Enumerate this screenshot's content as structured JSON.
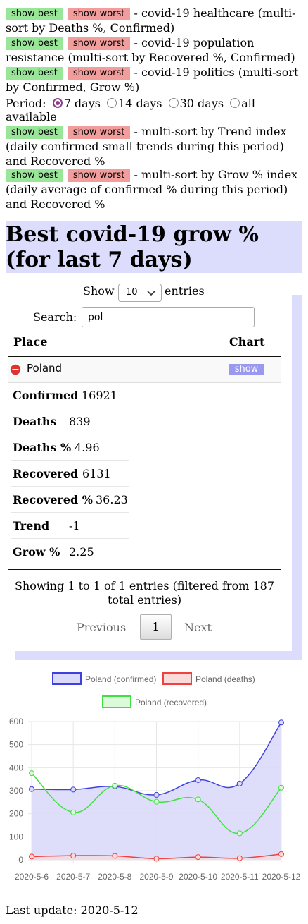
{
  "controls": {
    "show_best": "show best",
    "show_worst": "show worst",
    "rows": [
      {
        "text": "- covid-19 healthcare (multi-sort by Deaths %, Confirmed)"
      },
      {
        "text": "- covid-19 population resistance (multi-sort by Recovered %, Confirmed)"
      },
      {
        "text": "- covid-19 politics (multi-sort by Confirmed, Grow %)"
      },
      {
        "text": "- multi-sort by Trend index (daily confirmed small trends during this period) and Recovered %"
      },
      {
        "text": "- multi-sort by Grow % index (daily average of confirmed % during this period) and Recovered %"
      }
    ],
    "period_label": "Period:",
    "periods": [
      "7 days",
      "14 days",
      "30 days",
      "all available"
    ],
    "period_selected": "7 days"
  },
  "heading": "Best covid-19 grow % (for last 7 days)",
  "table": {
    "show_label": "Show",
    "entries_label": "entries",
    "page_size": "10",
    "search_label": "Search:",
    "search_value": "pol",
    "columns": [
      "Place",
      "Chart"
    ],
    "row": {
      "place": "Poland",
      "chart_button": "show",
      "details": [
        {
          "label": "Confirmed",
          "value": "16921"
        },
        {
          "label": "Deaths",
          "value": "839"
        },
        {
          "label": "Deaths %",
          "value": "4.96"
        },
        {
          "label": "Recovered",
          "value": "6131"
        },
        {
          "label": "Recovered %",
          "value": "36.23"
        },
        {
          "label": "Trend",
          "value": "-1"
        },
        {
          "label": "Grow %",
          "value": "2.25"
        }
      ]
    },
    "info": "Showing 1 to 1 of 1 entries (filtered from 187 total entries)",
    "prev": "Previous",
    "page": "1",
    "next": "Next"
  },
  "chart_data": {
    "type": "line",
    "categories": [
      "2020-5-6",
      "2020-5-7",
      "2020-5-8",
      "2020-5-9",
      "2020-5-10",
      "2020-5-11",
      "2020-5-12"
    ],
    "ylim": [
      0,
      600
    ],
    "yticks": [
      "0",
      "100",
      "200",
      "300",
      "400",
      "500",
      "600"
    ],
    "grid": true,
    "legend_position": "top",
    "series": [
      {
        "name": "Poland (confirmed)",
        "values": [
          307,
          305,
          318,
          282,
          346,
          331,
          596
        ],
        "color": "#4040e0",
        "fill": "#dadafa"
      },
      {
        "name": "Poland (deaths)",
        "values": [
          14,
          18,
          17,
          5,
          12,
          7,
          25
        ],
        "color": "#f04040",
        "fill": "#fbdada"
      },
      {
        "name": "Poland (recovered)",
        "values": [
          376,
          206,
          322,
          252,
          262,
          115,
          313
        ],
        "color": "#40e040",
        "fill": "#dafada"
      }
    ]
  },
  "footer": "Last update: 2020-5-12"
}
